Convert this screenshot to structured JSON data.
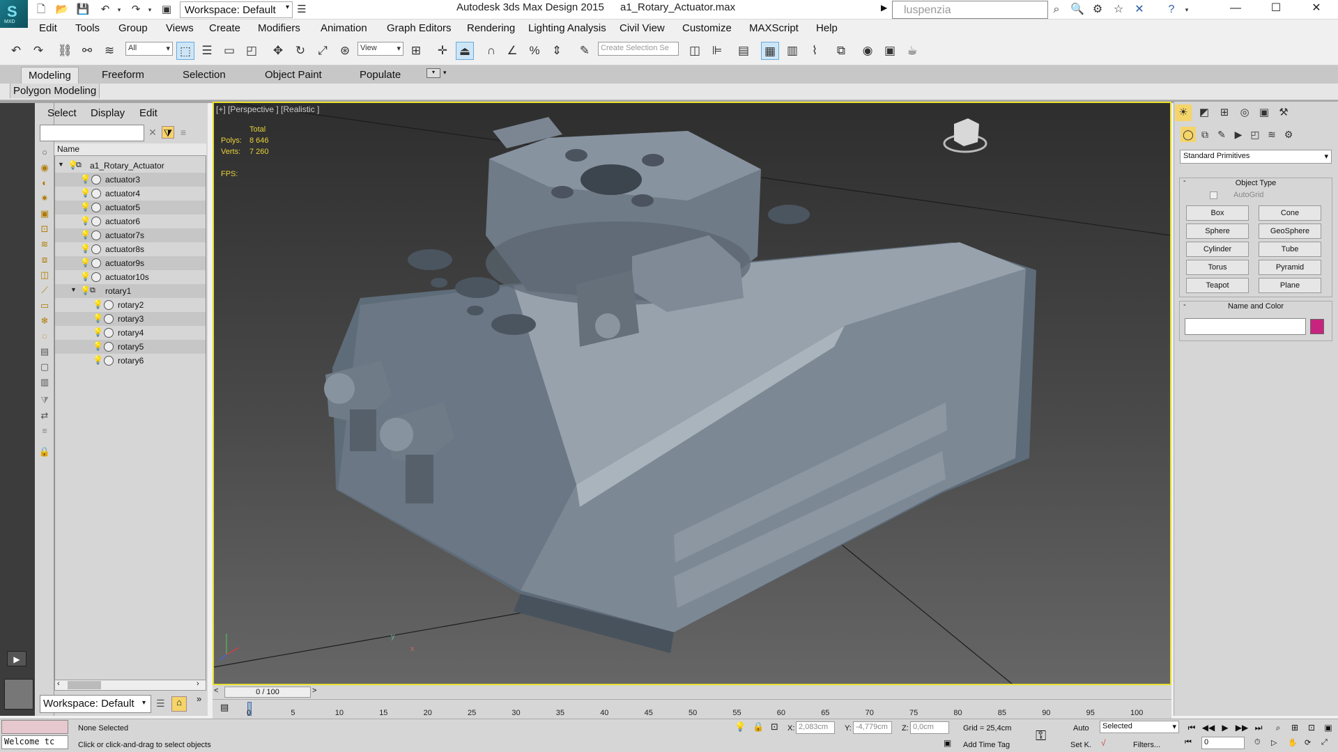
{
  "app": {
    "logo_text": "MXD",
    "workspace": "Workspace: Default",
    "title": "Autodesk 3ds Max Design 2015",
    "file": "a1_Rotary_Actuator.max",
    "search_placeholder": "luspenzia"
  },
  "menu": [
    "Edit",
    "Tools",
    "Group",
    "Views",
    "Create",
    "Modifiers",
    "Animation",
    "Graph Editors",
    "Rendering",
    "Lighting Analysis",
    "Civil View",
    "Customize",
    "MAXScript",
    "Help"
  ],
  "toolbar": {
    "selection_filter": "All",
    "ref_coord": "View",
    "named_selection_placeholder": "Create Selection Se"
  },
  "ribbon": {
    "tabs": [
      "Modeling",
      "Freeform",
      "Selection",
      "Object Paint",
      "Populate"
    ],
    "panel": "Polygon Modeling"
  },
  "explorer": {
    "menus": [
      "Select",
      "Display",
      "Edit"
    ],
    "column": "Name",
    "rows": [
      {
        "label": "a1_Rotary_Actuator",
        "level": 0,
        "expanded": true
      },
      {
        "label": "actuator3",
        "level": 1
      },
      {
        "label": "actuator4",
        "level": 1
      },
      {
        "label": "actuator5",
        "level": 1
      },
      {
        "label": "actuator6",
        "level": 1
      },
      {
        "label": "actuator7s",
        "level": 1
      },
      {
        "label": "actuator8s",
        "level": 1
      },
      {
        "label": "actuator9s",
        "level": 1
      },
      {
        "label": "actuator10s",
        "level": 1
      },
      {
        "label": "rotary1",
        "level": 1,
        "expanded": true
      },
      {
        "label": "rotary2",
        "level": 2
      },
      {
        "label": "rotary3",
        "level": 2
      },
      {
        "label": "rotary4",
        "level": 2
      },
      {
        "label": "rotary5",
        "level": 2
      },
      {
        "label": "rotary6",
        "level": 2
      }
    ],
    "workspace": "Workspace: Default"
  },
  "viewport": {
    "label": "[+] [Perspective ] [Realistic ]",
    "stats": {
      "total_label": "Total",
      "polys_label": "Polys:",
      "polys": "8 646",
      "verts_label": "Verts:",
      "verts": "7 260",
      "fps_label": "FPS:"
    }
  },
  "command_panel": {
    "dropdown": "Standard Primitives",
    "object_type": "Object Type",
    "autogrid": "AutoGrid",
    "buttons": [
      "Box",
      "Cone",
      "Sphere",
      "GeoSphere",
      "Cylinder",
      "Tube",
      "Torus",
      "Pyramid",
      "Teapot",
      "Plane"
    ],
    "name_and_color": "Name and Color",
    "color": "#c8247f"
  },
  "timeline": {
    "frame": "0 / 100",
    "ticks": [
      "0",
      "5",
      "10",
      "15",
      "20",
      "25",
      "30",
      "35",
      "40",
      "45",
      "50",
      "55",
      "60",
      "65",
      "70",
      "75",
      "80",
      "85",
      "90",
      "95",
      "100"
    ]
  },
  "status": {
    "welcome": "Welcome tc",
    "selection": "None Selected",
    "prompt": "Click or click-and-drag to select objects",
    "x_label": "X:",
    "x": "2,083cm",
    "y_label": "Y:",
    "y": "-4,779cm",
    "z_label": "Z:",
    "z": "0,0cm",
    "grid": "Grid = 25,4cm",
    "add_time_tag": "Add Time Tag",
    "auto": "Auto",
    "set_key": "Set K.",
    "selected": "Selected",
    "filters": "Filters...",
    "frame_field": "0"
  }
}
